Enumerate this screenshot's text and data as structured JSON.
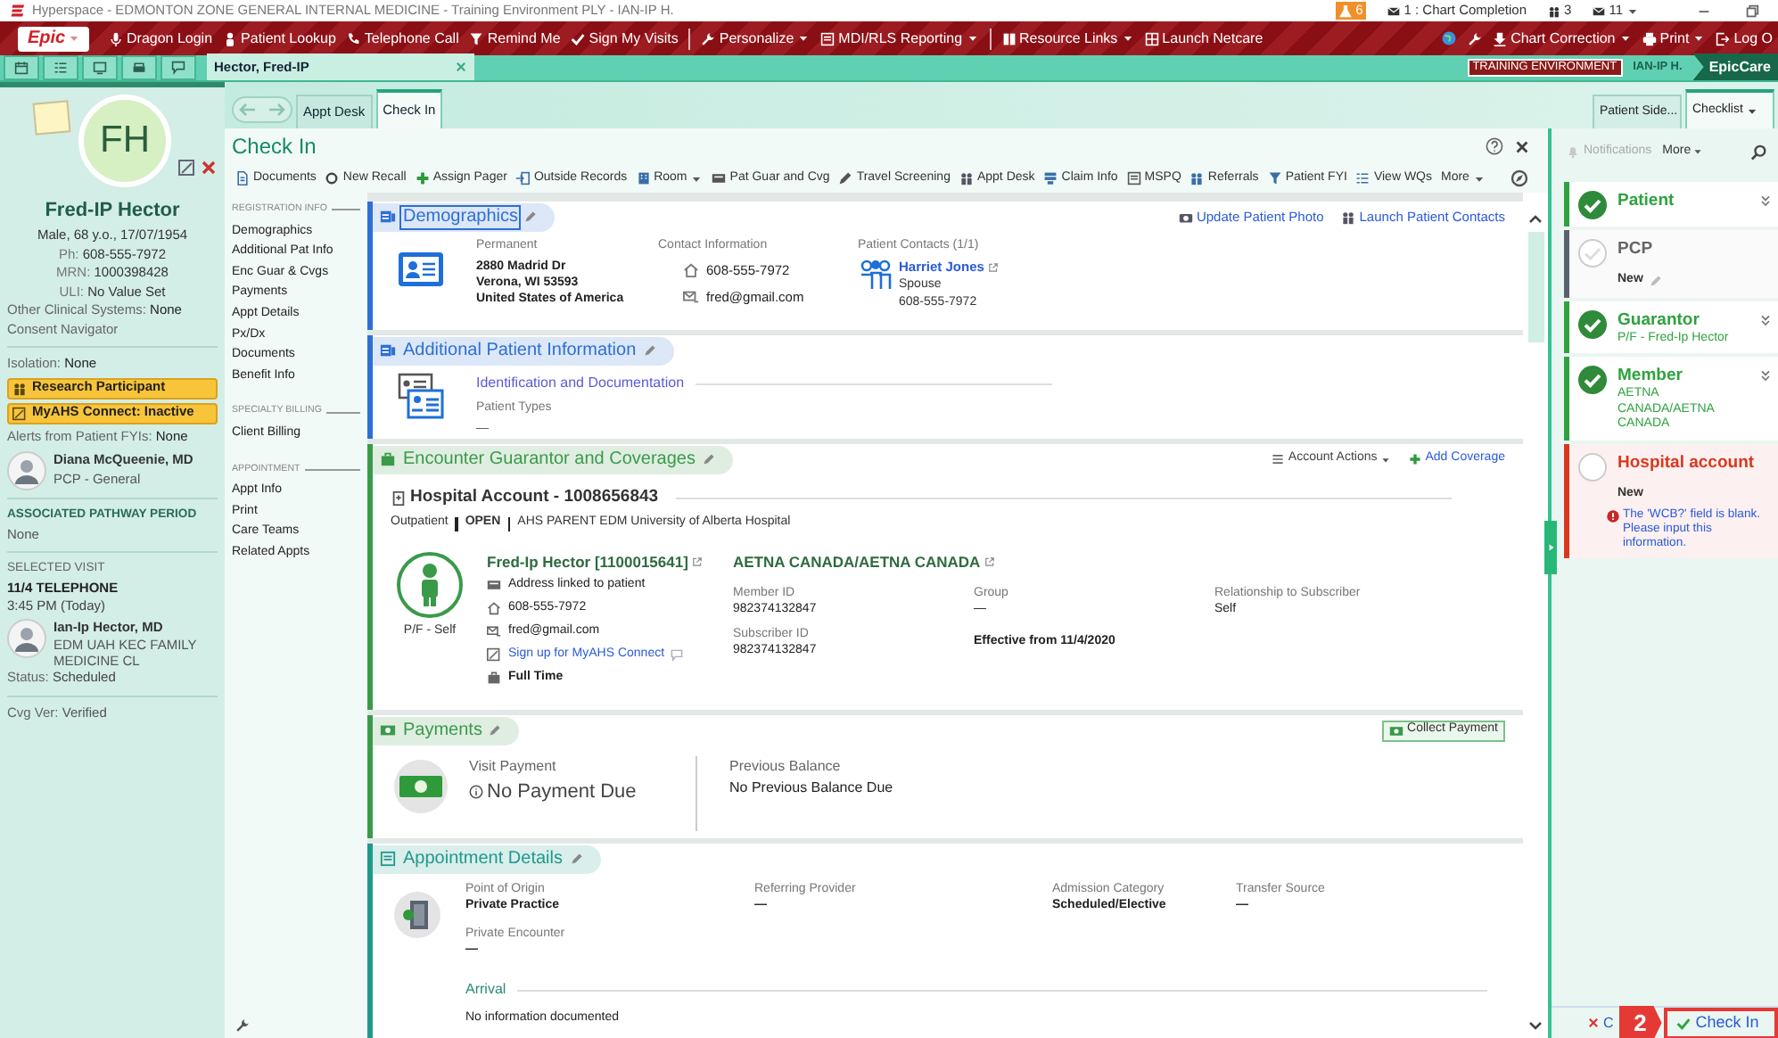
{
  "title_bar": {
    "title": "Hyperspace - EDMONTON ZONE GENERAL INTERNAL MEDICINE - Training Environment PLY - IAN-IP H.",
    "indicators": [
      {
        "kind": "results",
        "text": "6",
        "menu": false
      },
      {
        "kind": "mail",
        "text": "1 : Chart Completion",
        "menu": false
      },
      {
        "kind": "staff",
        "text": "3",
        "menu": false
      },
      {
        "kind": "mail",
        "text": "11",
        "menu": true
      }
    ]
  },
  "main_toolbar": {
    "logo": "Epic",
    "groups": [
      [
        {
          "label": "Dragon Login",
          "menu": false
        },
        {
          "label": "Patient Lookup",
          "menu": false
        },
        {
          "label": "Telephone Call",
          "menu": false
        },
        {
          "label": "Remind Me",
          "menu": false
        },
        {
          "label": "Sign My Visits",
          "menu": false
        }
      ],
      [
        {
          "label": "Personalize",
          "menu": true
        },
        {
          "label": "MDI/RLS Reporting",
          "menu": true
        }
      ],
      [
        {
          "label": "Resource Links",
          "menu": true
        },
        {
          "label": "Launch Netcare",
          "menu": false
        }
      ]
    ],
    "right_items": [
      {
        "label": "Chart Correction",
        "menu": true
      },
      {
        "label": "Print",
        "menu": true
      },
      {
        "label": "Log O",
        "menu": false
      }
    ]
  },
  "workspace_tabs": [
    {
      "label": "Hector, Fred-IP",
      "selected": true
    }
  ],
  "environment": {
    "banner": "TRAINING ENVIRONMENT",
    "user": "IAN-IP H.",
    "product": "EpicCare"
  },
  "patient": {
    "initials": "FH",
    "name": "Fred-IP Hector",
    "facts": [
      {
        "value": "Male, 68 y.o., 17/07/1954"
      },
      {
        "label": "Ph:",
        "value": "608-555-7972"
      },
      {
        "label": "MRN:",
        "value": "1000398428"
      },
      {
        "label": "ULI:",
        "value": "No Value Set"
      }
    ],
    "other": [
      {
        "label": "Other Clinical Systems:",
        "value": "None"
      },
      {
        "label": "Consent Navigator"
      }
    ],
    "isolation": {
      "label": "Isolation:",
      "value": "None"
    },
    "flags": [
      "Research Participant",
      "MyAHS Connect: Inactive"
    ],
    "alerts": {
      "label": "Alerts from Patient FYIs:",
      "value": "None"
    },
    "pcp": {
      "name": "Diana McQueenie, MD",
      "role": "PCP - General"
    },
    "pathway": {
      "heading": "ASSOCIATED PATHWAY PERIOD",
      "value": "None"
    },
    "selected_visit": {
      "heading": "SELECTED VISIT",
      "type": "11/4 TELEPHONE",
      "time": "3:45 PM (Today)",
      "provider": "Ian-Ip Hector, MD",
      "department": "EDM UAH KEC FAMILY MEDICINE CL",
      "status": {
        "label": "Status:",
        "value": "Scheduled"
      }
    },
    "coverage_verification": {
      "label": "Cvg Ver:",
      "value": "Verified"
    }
  },
  "activity_tabs": [
    {
      "label": "Appt Desk",
      "selected": false
    },
    {
      "label": "Check In",
      "selected": true
    }
  ],
  "activity": {
    "title": "Check In",
    "toolbar": [
      {
        "label": "Documents",
        "menu": false
      },
      {
        "label": "New Recall",
        "menu": false
      },
      {
        "label": "Assign Pager",
        "menu": false
      },
      {
        "label": "Outside Records",
        "menu": false
      },
      {
        "label": "Room",
        "menu": true
      },
      {
        "label": "Pat Guar and Cvg",
        "menu": false
      },
      {
        "label": "Travel Screening",
        "menu": false
      },
      {
        "label": "Appt Desk",
        "menu": false
      },
      {
        "label": "Claim Info",
        "menu": false
      },
      {
        "label": "MSPQ",
        "menu": false
      },
      {
        "label": "Referrals",
        "menu": false
      },
      {
        "label": "Patient FYI",
        "menu": false
      },
      {
        "label": "View WQs",
        "menu": false
      },
      {
        "label": "More",
        "menu": true
      }
    ],
    "nav": [
      {
        "heading": "REGISTRATION INFO",
        "items": [
          "Demographics",
          "Additional Pat Info",
          "Enc Guar & Cvgs",
          "Payments",
          "Appt Details",
          "Px/Dx",
          "Documents",
          "Benefit Info"
        ]
      },
      {
        "heading": "SPECIALTY BILLING",
        "items": [
          "Client Billing"
        ]
      },
      {
        "heading": "APPOINTMENT",
        "items": [
          "Appt Info",
          "Print",
          "Care Teams",
          "Related Appts"
        ]
      }
    ],
    "sections": [
      {
        "kind": "demographics",
        "title": "Demographics",
        "color": "#2d6fd6",
        "focused": true,
        "links": [
          "Update Patient Photo",
          "Launch Patient Contacts"
        ],
        "address": {
          "label": "Permanent",
          "lines": [
            "2880 Madrid Dr",
            "Verona, WI 53593",
            "United States of America"
          ]
        },
        "contact": {
          "label": "Contact Information",
          "phone": "608-555-7972",
          "email": "fred@gmail.com"
        },
        "contacts": {
          "label": "Patient Contacts (1/1)",
          "name": "Harriet Jones",
          "relation": "Spouse",
          "phone": "608-555-7972"
        }
      },
      {
        "kind": "additional",
        "title": "Additional Patient Information",
        "color": "#2d6fd6",
        "focused": false,
        "subsection": "Identification and Documentation",
        "field": {
          "label": "Patient Types",
          "value": "—"
        }
      },
      {
        "kind": "guarantor",
        "title": "Encounter Guarantor and Coverages",
        "color": "#3a9a4a",
        "focused": false,
        "actions": [
          {
            "label": "Account Actions",
            "kind": "menu"
          },
          {
            "label": "Add Coverage",
            "kind": "add"
          }
        ],
        "account": "Hospital Account - 1008656843",
        "account_info": [
          "Outpatient",
          "OPEN",
          "AHS PARENT EDM University of Alberta Hospital"
        ],
        "guarantor": {
          "badge": "P/F - Self",
          "name": "Fred-Ip Hector [1100015641]",
          "details": [
            {
              "kind": "address",
              "text": "Address linked to patient"
            },
            {
              "kind": "phone",
              "text": "608-555-7972"
            },
            {
              "kind": "email",
              "text": "fred@gmail.com"
            },
            {
              "kind": "link",
              "text": "Sign up for MyAHS Connect"
            },
            {
              "kind": "employment",
              "text": "Full Time"
            }
          ]
        },
        "coverage": {
          "payer": "AETNA CANADA/AETNA CANADA",
          "fields": [
            {
              "label": "Member ID",
              "value": "982374132847"
            },
            {
              "label": "Group",
              "value": "—"
            },
            {
              "label": "Relationship to Subscriber",
              "value": "Self"
            },
            {
              "label": "Subscriber ID",
              "value": "982374132847"
            },
            {
              "value": "Effective from 11/4/2020"
            }
          ]
        }
      },
      {
        "kind": "payments",
        "title": "Payments",
        "color": "#3a9a4a",
        "focused": false,
        "button": "Collect Payment",
        "visit": {
          "label": "Visit Payment",
          "value": "No Payment Due"
        },
        "balance": {
          "label": "Previous Balance",
          "value": "No Previous Balance Due"
        }
      },
      {
        "kind": "appointment",
        "title": "Appointment Details",
        "color": "#1f9a8a",
        "focused": false,
        "fields": [
          {
            "label": "Point of Origin",
            "value": "Private Practice"
          },
          {
            "label": "Referring Provider",
            "value": "—"
          },
          {
            "label": "Admission Category",
            "value": "Scheduled/Elective"
          },
          {
            "label": "Transfer Source",
            "value": "—"
          },
          {
            "label": "Private Encounter",
            "value": "—"
          }
        ],
        "arrival": {
          "label": "Arrival",
          "value": "No information documented"
        }
      }
    ]
  },
  "side_tabs": [
    {
      "label": "Patient Side...",
      "selected": false,
      "menu": false
    },
    {
      "label": "Checklist",
      "selected": true,
      "menu": true
    }
  ],
  "side_toolbar": {
    "notifications": {
      "label": "Notifications",
      "disabled": true
    },
    "more": "More"
  },
  "checklist": [
    {
      "title": "Patient",
      "kind": "complete",
      "expandable": true,
      "editable": false
    },
    {
      "title": "PCP",
      "kind": "pending",
      "note": "New",
      "expandable": false,
      "editable": true
    },
    {
      "title": "Guarantor",
      "kind": "complete",
      "detail": "P/F - Fred-Ip Hector",
      "expandable": true,
      "editable": false
    },
    {
      "title": "Member",
      "kind": "complete",
      "detail": "AETNA CANADA/AETNA CANADA",
      "expandable": true,
      "editable": false
    },
    {
      "title": "Hospital account",
      "kind": "error",
      "note": "New",
      "error": "The 'WCB?' field is blank. Please input this information.",
      "expandable": false,
      "editable": false
    }
  ],
  "footer": {
    "cancel": "C",
    "callout": "2",
    "primary": "Check In"
  }
}
